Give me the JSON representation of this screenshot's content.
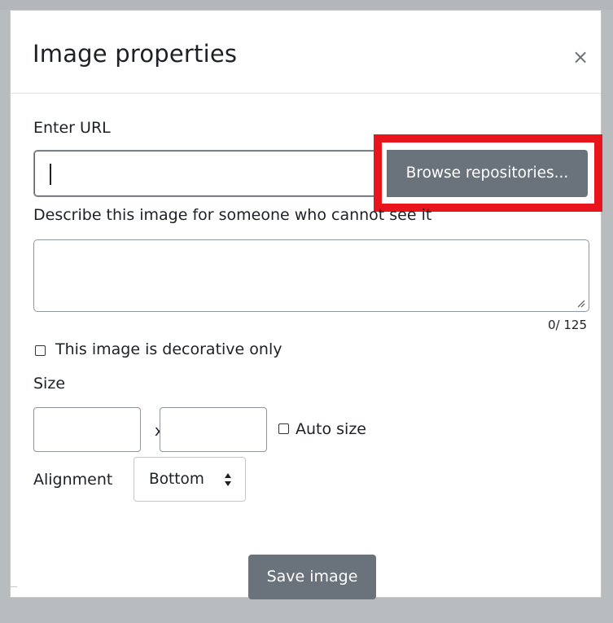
{
  "dialog": {
    "title": "Image properties",
    "close_symbol": "×"
  },
  "url": {
    "label": "Enter URL",
    "value": "",
    "browse_label": "Browse repositories..."
  },
  "alt_text": {
    "label": "Describe this image for someone who cannot see it",
    "value": "",
    "char_count": "0/ 125"
  },
  "decorative": {
    "label": "This image is decorative only",
    "checked": false
  },
  "size": {
    "label": "Size",
    "width_value": "",
    "height_value": "",
    "separator": "x",
    "auto_label": "Auto size",
    "auto_checked": false
  },
  "alignment": {
    "label": "Alignment",
    "selected": "Bottom"
  },
  "actions": {
    "save_label": "Save image"
  },
  "icons": {
    "close": "close-icon",
    "resize": "resize-grip-icon",
    "sort": "sort-arrows-icon"
  },
  "colors": {
    "highlight": "#e8161c",
    "button": "#6a737b",
    "backdrop": "#b9bcbf"
  }
}
